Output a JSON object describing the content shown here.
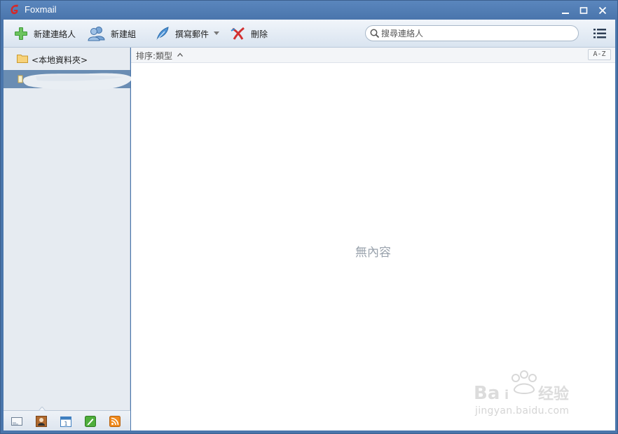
{
  "window": {
    "title": "Foxmail",
    "accent": "#4a76ac",
    "logo_color": "#d42a2a"
  },
  "toolbar": {
    "new_contact_label": "新建連絡人",
    "new_group_label": "新建組",
    "compose_label": "撰寫郵件",
    "delete_label": "刪除",
    "search_placeholder": "搜尋連絡人"
  },
  "sidebar": {
    "folder_label": "<本地資料夾>",
    "selected_color": "#6a8db3",
    "bottom_nav": [
      {
        "icon": "mail-icon"
      },
      {
        "icon": "contacts-icon",
        "active": true
      },
      {
        "icon": "calendar-icon",
        "day": "1"
      },
      {
        "icon": "notes-icon"
      },
      {
        "icon": "rss-icon"
      }
    ]
  },
  "content": {
    "sort_label": "排序:類型",
    "az_label": "A-Z",
    "empty_message": "無內容"
  },
  "watermark": {
    "text": "jingyan.baidu.com"
  }
}
